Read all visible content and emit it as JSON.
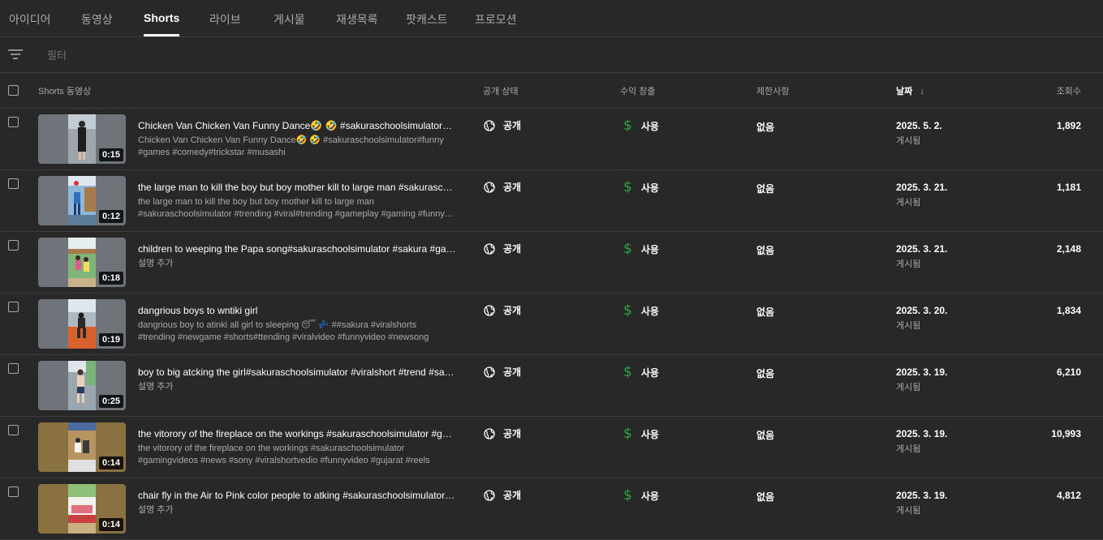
{
  "tabs": [
    "아이디어",
    "동영상",
    "Shorts",
    "라이브",
    "게시물",
    "재생목록",
    "팟캐스트",
    "프로모션"
  ],
  "active_tab": "Shorts",
  "filter": {
    "placeholder": "필터"
  },
  "columns": {
    "video": "Shorts 동영상",
    "visibility": "공개 상태",
    "monetization": "수익 창출",
    "restrictions": "제한사항",
    "date": "날짜",
    "date_sort": "↓",
    "views": "조회수"
  },
  "rows": [
    {
      "duration": "0:15",
      "title": "Chicken Van Chicken Van Funny Dance🤣 🤣 #sakuraschoolsimulator#funny #games #comedy#trickstar #musashi",
      "desc1": "Chicken Van Chicken Van Funny Dance🤣 🤣 #sakuraschoolsimulator#funny",
      "desc2": "#games #comedy#trickstar #musashi",
      "visibility": "공개",
      "monetization": "사용",
      "restrictions": "없음",
      "date": "2025. 5. 2.",
      "date_status": "게시됨",
      "views": "1,892"
    },
    {
      "duration": "0:12",
      "title": "the large man to kill the boy but boy mother kill to large man #sakuraschoolsimulator",
      "desc1": "the large man to kill the boy but boy mother kill to large man",
      "desc2": "#sakuraschoolsimulator #trending #viral#trending #gameplay #gaming #funnyvideo",
      "visibility": "공개",
      "monetization": "사용",
      "restrictions": "없음",
      "date": "2025. 3. 21.",
      "date_status": "게시됨",
      "views": "1,181"
    },
    {
      "duration": "0:18",
      "title": "children to weeping the Papa song#sakuraschoolsimulator #sakura #gaming",
      "desc1": "설명 추가",
      "desc2": "",
      "visibility": "공개",
      "monetization": "사용",
      "restrictions": "없음",
      "date": "2025. 3. 21.",
      "date_status": "게시됨",
      "views": "2,148"
    },
    {
      "duration": "0:19",
      "title": "dangrious boys to wntiki girl",
      "desc1": "dangrious boy to atinki all girl to sleeping 😴 💤 ##sakura #viralshorts",
      "desc2": "#trending #newgame #shorts#ttending #viralvideo #funnyvideo #newsong",
      "visibility": "공개",
      "monetization": "사용",
      "restrictions": "없음",
      "date": "2025. 3. 20.",
      "date_status": "게시됨",
      "views": "1,834"
    },
    {
      "duration": "0:25",
      "title": "boy to big atcking the girl#sakuraschoolsimulator #viralshort #trend #sakura",
      "desc1": "설명 추가",
      "desc2": "",
      "visibility": "공개",
      "monetization": "사용",
      "restrictions": "없음",
      "date": "2025. 3. 19.",
      "date_status": "게시됨",
      "views": "6,210"
    },
    {
      "duration": "0:14",
      "title": "the vitorory of the fireplace on the workings #sakuraschoolsimulator #gamingvideos",
      "desc1": "the vitorory of the fireplace on the workings #sakuraschoolsimulator",
      "desc2": "#gamingvideos #news #sony #viralshortvedio #funnyvideo #gujarat #reels",
      "visibility": "공개",
      "monetization": "사용",
      "restrictions": "없음",
      "date": "2025. 3. 19.",
      "date_status": "게시됨",
      "views": "10,993"
    },
    {
      "duration": "0:14",
      "title": "chair fly in the Air to Pink color people to atking #sakuraschoolsimulator #sakura",
      "desc1": "설명 추가",
      "desc2": "",
      "visibility": "공개",
      "monetization": "사용",
      "restrictions": "없음",
      "date": "2025. 3. 19.",
      "date_status": "게시됨",
      "views": "4,812"
    }
  ],
  "colors": {
    "background": "#282828",
    "divider": "#3e3e3e",
    "monetization_green": "#2ba640",
    "muted_text": "#aaaaaa"
  }
}
